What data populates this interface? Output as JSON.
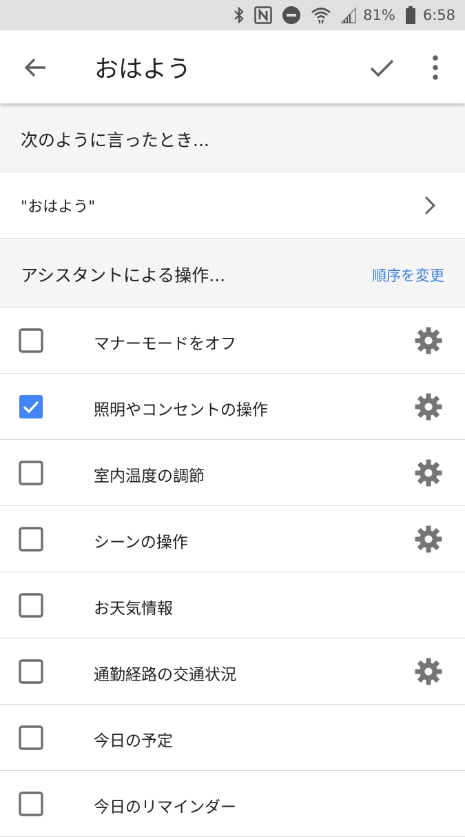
{
  "status_bar": {
    "battery_percent": "81%",
    "time": "6:58",
    "icons": [
      "bluetooth-icon",
      "nfc-icon",
      "do-not-disturb-icon",
      "wifi-icon",
      "signal-icon",
      "battery-icon"
    ]
  },
  "app_bar": {
    "title": "おはよう",
    "icons": [
      "back-arrow-icon",
      "check-icon",
      "more-vert-icon"
    ]
  },
  "trigger_section": {
    "header": "次のように言ったとき...",
    "phrase": "\"おはよう\""
  },
  "actions_section": {
    "header": "アシスタントによる操作...",
    "reorder_link": "順序を変更"
  },
  "actions": [
    {
      "label": "マナーモードをオフ",
      "checked": false,
      "has_settings": true
    },
    {
      "label": "照明やコンセントの操作",
      "checked": true,
      "has_settings": true
    },
    {
      "label": "室内温度の調節",
      "checked": false,
      "has_settings": true
    },
    {
      "label": "シーンの操作",
      "checked": false,
      "has_settings": true
    },
    {
      "label": "お天気情報",
      "checked": false,
      "has_settings": false
    },
    {
      "label": "通勤経路の交通状況",
      "checked": false,
      "has_settings": true
    },
    {
      "label": "今日の予定",
      "checked": false,
      "has_settings": false
    },
    {
      "label": "今日のリマインダー",
      "checked": false,
      "has_settings": false
    }
  ],
  "colors": {
    "accent": "#4285f4",
    "link": "#3b7de0",
    "icon_gray": "#757575"
  }
}
